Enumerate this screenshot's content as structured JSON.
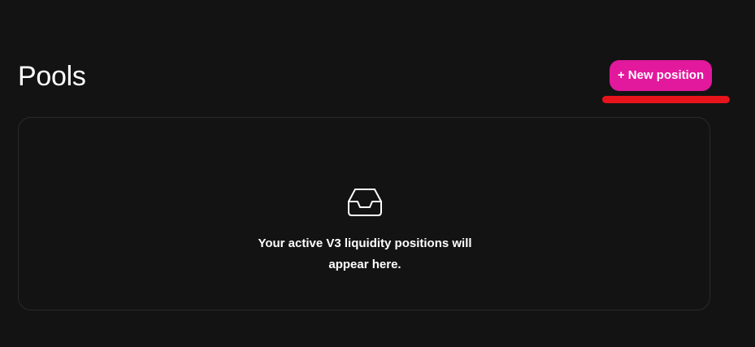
{
  "header": {
    "title": "Pools",
    "new_position_label": "+ New position"
  },
  "annotation": {
    "underline_color": "#e8141c"
  },
  "positions": {
    "icon": "inbox-icon",
    "empty_message": "Your active V3 liquidity positions will appear here."
  },
  "colors": {
    "background": "#131313",
    "accent": "#e2189d",
    "card_border": "#2a2a2a",
    "text": "#ffffff"
  }
}
